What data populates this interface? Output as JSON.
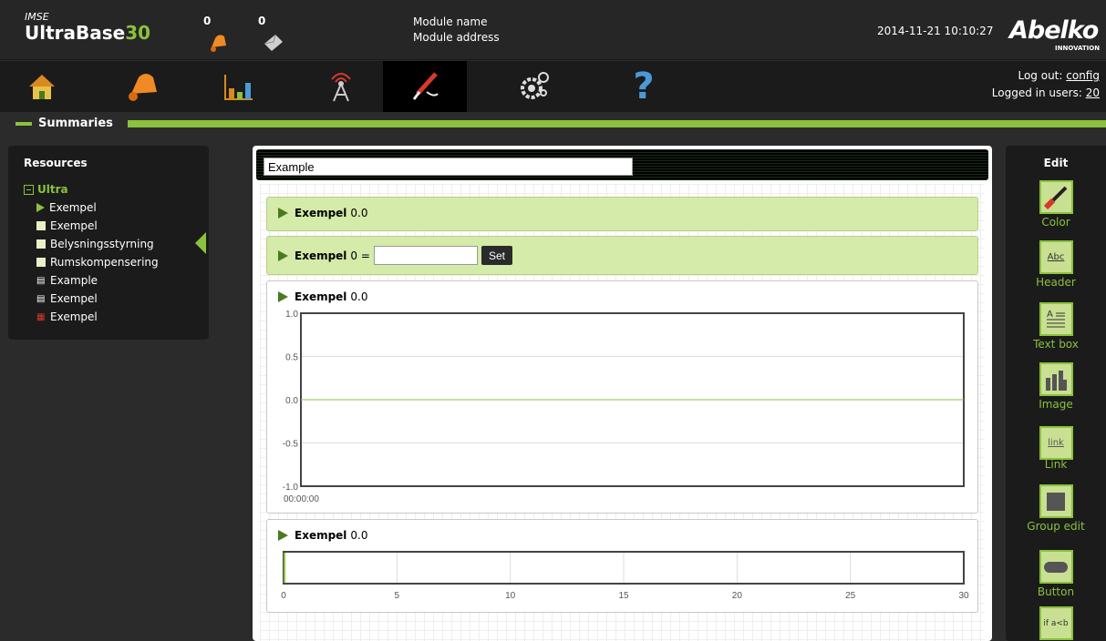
{
  "header": {
    "brand_small": "IMSE",
    "brand_name": "UltraBase",
    "brand_number": "30",
    "alarm_count": "0",
    "message_count": "0",
    "module_name": "Module name",
    "module_address": "Module address",
    "datetime": "2014-11-21 10:10:27",
    "logo": "Abelko",
    "logo_sub": "INNOVATION"
  },
  "nav": {
    "items": [
      {
        "icon": "home-icon"
      },
      {
        "icon": "alarm-bell-icon"
      },
      {
        "icon": "bar-chart-icon"
      },
      {
        "icon": "antenna-icon"
      },
      {
        "icon": "tools-icon"
      },
      {
        "icon": "gears-icon"
      },
      {
        "icon": "help-icon"
      }
    ],
    "logout_label": "Log out:",
    "logout_user": "config",
    "logged_in_label": "Logged in users:",
    "logged_in_count": "20"
  },
  "section_title": "Summaries",
  "resources": {
    "title": "Resources",
    "root": "Ultra",
    "items": [
      {
        "label": "Exempel",
        "icon": "triangle"
      },
      {
        "label": "Exempel",
        "icon": "square"
      },
      {
        "label": "Belysningsstyrning",
        "icon": "square"
      },
      {
        "label": "Rumskompensering",
        "icon": "square"
      },
      {
        "label": "Example",
        "icon": "list"
      },
      {
        "label": "Exempel",
        "icon": "list"
      },
      {
        "label": "Exempel",
        "icon": "table"
      }
    ]
  },
  "canvas": {
    "title_value": "Example",
    "widgets": [
      {
        "name": "Exempel",
        "value": "0.0"
      },
      {
        "name": "Exempel",
        "value": "0 =",
        "set_label": "Set"
      },
      {
        "name": "Exempel",
        "value": "0.0"
      },
      {
        "name": "Exempel",
        "value": "0.0"
      }
    ]
  },
  "chart_data": [
    {
      "type": "line",
      "x": [
        "00:00:00"
      ],
      "series": [
        {
          "values": [
            0.0
          ]
        }
      ],
      "yticks": [
        "1.0",
        "0.5",
        "0.0",
        "-0.5",
        "-1.0"
      ],
      "ylim": [
        -1.0,
        1.0
      ],
      "xtick": "00:00:00"
    },
    {
      "type": "bar",
      "xticks": [
        "0",
        "5",
        "10",
        "15",
        "20",
        "25",
        "30"
      ],
      "xlim": [
        0,
        30
      ],
      "values": [
        0.0
      ]
    }
  ],
  "edit_panel": {
    "title": "Edit",
    "tools": [
      {
        "label": "Color",
        "icon": "paintbrush-icon"
      },
      {
        "label": "Header",
        "icon": "header-icon",
        "text": "Abc"
      },
      {
        "label": "Text box",
        "icon": "textbox-icon"
      },
      {
        "label": "Image",
        "icon": "image-icon"
      },
      {
        "label": "Link",
        "icon": "link-icon",
        "text": "link"
      },
      {
        "label": "Group edit",
        "icon": "group-edit-icon"
      },
      {
        "label": "Button",
        "icon": "button-icon"
      },
      {
        "label": "",
        "icon": "condition-icon",
        "text": "if a<b"
      }
    ]
  },
  "colors": {
    "accent": "#8ac23d",
    "dark": "#1b1b1b",
    "widget_green": "#d4eba9"
  }
}
